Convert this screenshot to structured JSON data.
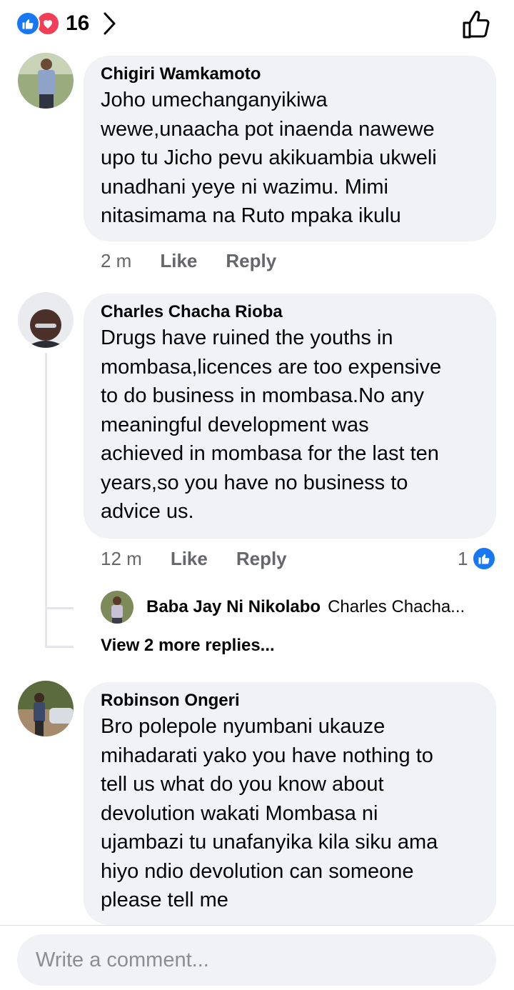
{
  "header": {
    "reaction_count": "16",
    "reaction_icons": [
      "like-icon",
      "love-icon"
    ],
    "chevron_icon": "chevron-right-icon",
    "like_action_icon": "thumbs-up-outline-icon"
  },
  "comments": [
    {
      "author": "Chigiri Wamkamoto",
      "text": "Joho umechanganyikiwa\nwewe,unaacha pot inaenda nawewe\nupo tu Jicho pevu akikuambia ukweli\nunadhani yeye ni wazimu. Mimi\nnitasimama na Ruto mpaka ikulu",
      "time": "2 m",
      "like_label": "Like",
      "reply_label": "Reply"
    },
    {
      "author": "Charles Chacha Rioba",
      "text": "Drugs have ruined the youths  in\nmombasa,licences are too expensive\nto do business in mombasa.No any\nmeaningful development was\nachieved in mombasa for the last ten\nyears,so you have no business to\nadvice us.",
      "time": "12 m",
      "like_label": "Like",
      "reply_label": "Reply",
      "like_count": "1",
      "reply_preview": {
        "author": "Baba Jay Ni Nikolabo",
        "snippet": "Charles Chacha..."
      },
      "view_more": "View 2 more replies..."
    },
    {
      "author": "Robinson Ongeri",
      "text": "Bro polepole nyumbani ukauze\nmihadarati yako you have nothing to\ntell us what do you know about\ndevolution wakati Mombasa ni\nujambazi tu unafanyika kila siku ama\nhiyo ndio devolution can someone\nplease tell me"
    }
  ],
  "composer": {
    "placeholder": "Write a comment..."
  },
  "colors": {
    "like_blue": "#1877f2",
    "love_red": "#f33e58",
    "bubble_bg": "#f0f2f5",
    "meta_gray": "#65676b"
  }
}
